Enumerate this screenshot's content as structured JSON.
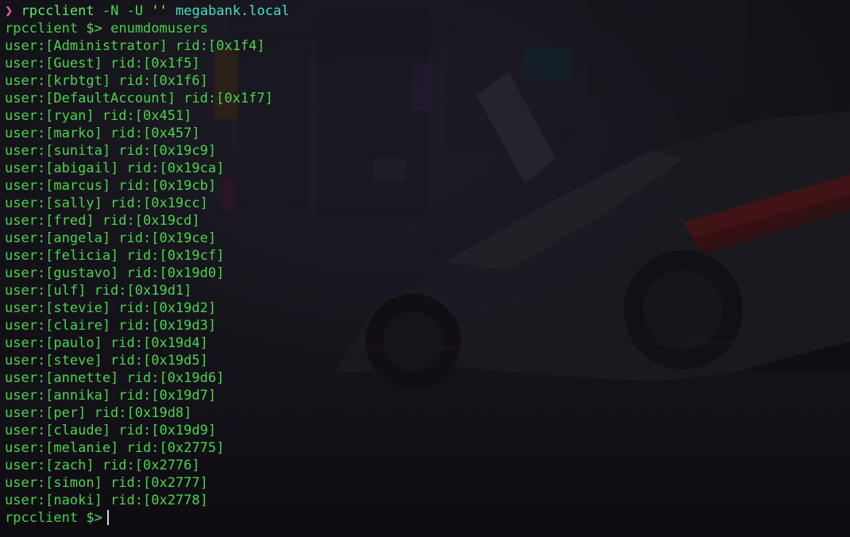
{
  "terminal": {
    "command_line": {
      "arrow": "❯",
      "program": "rpcclient",
      "flags": "-N -U",
      "quotes": "''",
      "host": "megabank.local"
    },
    "prompt_line": {
      "name": "rpcclient",
      "symbol": "$>",
      "command": "enumdomusers"
    },
    "users": [
      "user:[Administrator] rid:[0x1f4]",
      "user:[Guest] rid:[0x1f5]",
      "user:[krbtgt] rid:[0x1f6]",
      "user:[DefaultAccount] rid:[0x1f7]",
      "user:[ryan] rid:[0x451]",
      "user:[marko] rid:[0x457]",
      "user:[sunita] rid:[0x19c9]",
      "user:[abigail] rid:[0x19ca]",
      "user:[marcus] rid:[0x19cb]",
      "user:[sally] rid:[0x19cc]",
      "user:[fred] rid:[0x19cd]",
      "user:[angela] rid:[0x19ce]",
      "user:[felicia] rid:[0x19cf]",
      "user:[gustavo] rid:[0x19d0]",
      "user:[ulf] rid:[0x19d1]",
      "user:[stevie] rid:[0x19d2]",
      "user:[claire] rid:[0x19d3]",
      "user:[paulo] rid:[0x19d4]",
      "user:[steve] rid:[0x19d5]",
      "user:[annette] rid:[0x19d6]",
      "user:[annika] rid:[0x19d7]",
      "user:[per] rid:[0x19d8]",
      "user:[claude] rid:[0x19d9]",
      "user:[melanie] rid:[0x2775]",
      "user:[zach] rid:[0x2776]",
      "user:[simon] rid:[0x2777]",
      "user:[naoki] rid:[0x2778]"
    ],
    "final_prompt": {
      "name": "rpcclient",
      "symbol": "$>"
    }
  },
  "colors": {
    "background": "#17151a",
    "output_text": "#4cd34c",
    "prompt_arrow": "#e35fae",
    "host": "#45e0c6",
    "quotes": "#e0d062",
    "cursor": "#d8d8d8"
  },
  "icons": {
    "prompt_arrow": "chevron-right-icon",
    "cursor": "text-cursor-icon"
  }
}
